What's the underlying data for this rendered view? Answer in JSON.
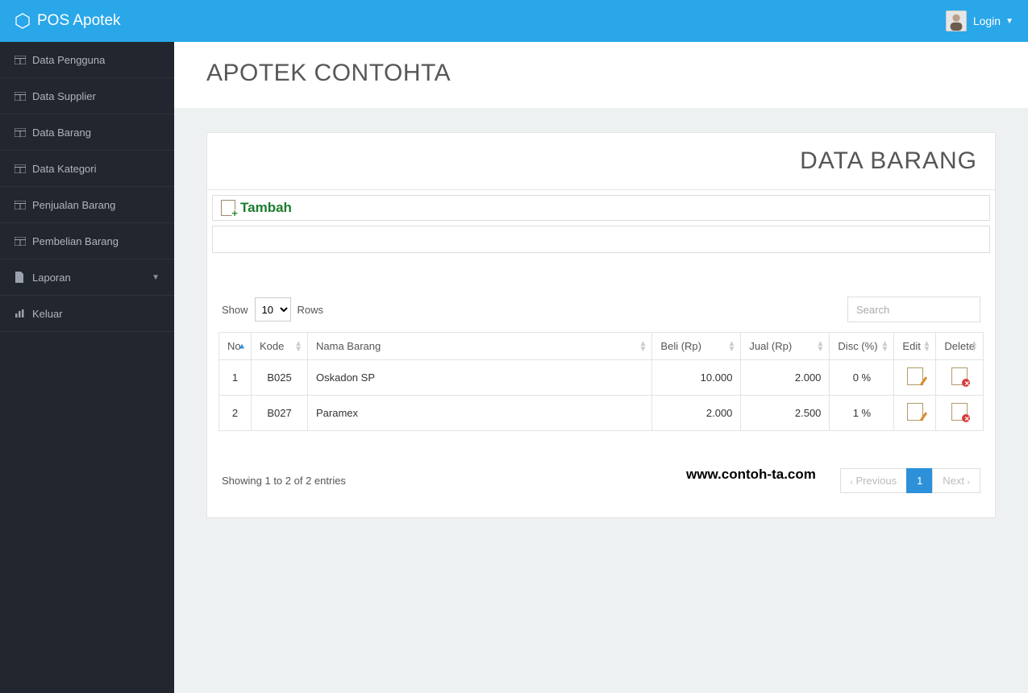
{
  "brand": "POS Apotek",
  "login_label": "Login",
  "sidebar": {
    "items": [
      {
        "label": "Data Pengguna"
      },
      {
        "label": "Data Supplier"
      },
      {
        "label": "Data Barang"
      },
      {
        "label": "Data Kategori"
      },
      {
        "label": "Penjualan Barang"
      },
      {
        "label": "Pembelian Barang"
      },
      {
        "label": "Laporan"
      },
      {
        "label": "Keluar"
      }
    ]
  },
  "page_heading": "APOTEK CONTOHTA",
  "card_title": "DATA BARANG",
  "tambah_label": "Tambah",
  "show_label": "Show",
  "rows_label": "Rows",
  "rows_options": [
    "10"
  ],
  "rows_selected": "10",
  "search_placeholder": "Search",
  "columns": {
    "no": "No",
    "kode": "Kode",
    "nama": "Nama Barang",
    "beli": "Beli (Rp)",
    "jual": "Jual (Rp)",
    "disc": "Disc (%)",
    "edit": "Edit",
    "delete": "Delete"
  },
  "rows": [
    {
      "no": "1",
      "kode": "B025",
      "nama": "Oskadon SP",
      "beli": "10.000",
      "jual": "2.000",
      "disc": "0 %"
    },
    {
      "no": "2",
      "kode": "B027",
      "nama": "Paramex",
      "beli": "2.000",
      "jual": "2.500",
      "disc": "1 %"
    }
  ],
  "info_text": "Showing 1 to 2 of 2 entries",
  "watermark": "www.contoh-ta.com",
  "pagination": {
    "prev": "Previous",
    "next": "Next",
    "current": "1"
  }
}
